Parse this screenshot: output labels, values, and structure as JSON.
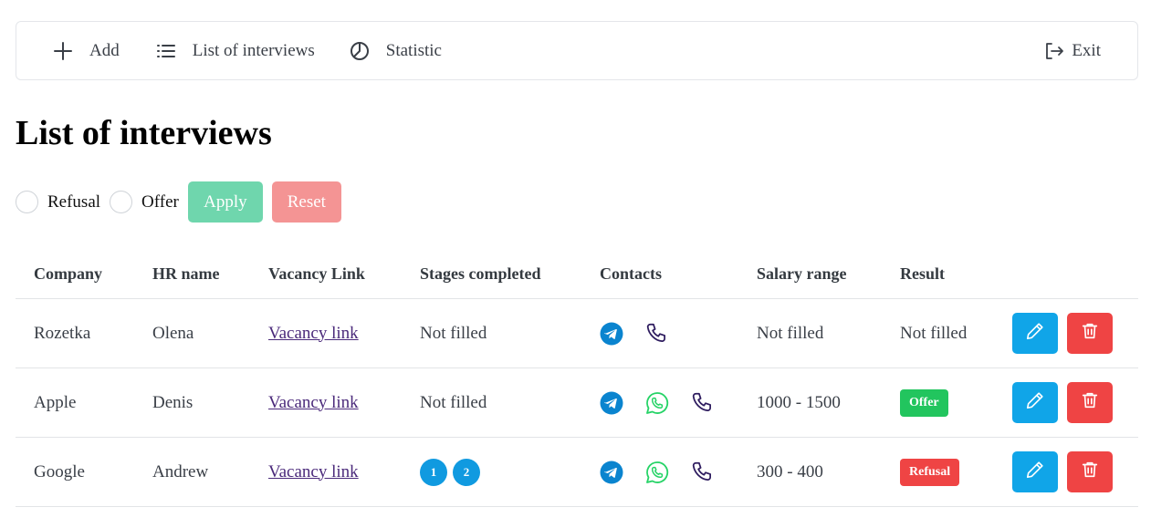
{
  "nav": {
    "add_label": "Add",
    "list_label": "List of interviews",
    "stats_label": "Statistic",
    "exit_label": "Exit"
  },
  "page": {
    "title": "List of interviews"
  },
  "filters": {
    "refusal_label": "Refusal",
    "offer_label": "Offer",
    "apply_label": "Apply",
    "reset_label": "Reset"
  },
  "table": {
    "headers": {
      "company": "Company",
      "hr_name": "HR name",
      "vacancy_link": "Vacancy Link",
      "stages": "Stages completed",
      "contacts": "Contacts",
      "salary": "Salary range",
      "result": "Result"
    },
    "rows": [
      {
        "company": "Rozetka",
        "hr_name": "Olena",
        "vacancy": "Vacancy link",
        "stages_text": "Not filled",
        "salary": "Not filled",
        "result_text": "Not filled",
        "contacts": [
          "telegram-icon",
          "phone-icon"
        ]
      },
      {
        "company": "Apple",
        "hr_name": "Denis",
        "vacancy": "Vacancy link",
        "stages_text": "Not filled",
        "salary": "1000 - 1500",
        "result_badge": "Offer",
        "contacts": [
          "telegram-icon",
          "whatsapp-icon",
          "phone-icon"
        ]
      },
      {
        "company": "Google",
        "hr_name": "Andrew",
        "vacancy": "Vacancy link",
        "stages": [
          "1",
          "2"
        ],
        "salary": "300 - 400",
        "result_badge": "Refusal",
        "contacts": [
          "telegram-icon",
          "whatsapp-icon",
          "phone-icon"
        ]
      }
    ]
  },
  "colors": {
    "apply": "#6fd6ad",
    "reset": "#f49494",
    "edit": "#10a5e8",
    "delete": "#ef4444",
    "offer": "#22c55e",
    "refusal": "#ef4444",
    "stage": "#109ae0",
    "telegram": "#0a84cf",
    "whatsapp": "#25d366",
    "phone": "#2d1b5e"
  }
}
